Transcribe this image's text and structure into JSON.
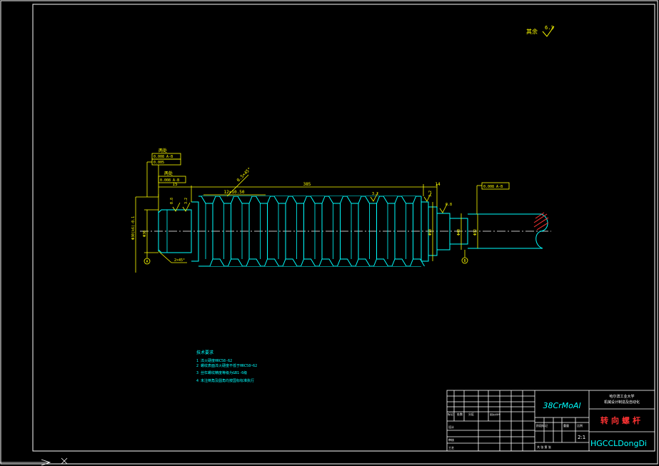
{
  "surface_finish": {
    "label": "其余",
    "value": "6.3"
  },
  "dims": {
    "two_places_a": "两处",
    "two_places_b": "两处",
    "tol_frame_a": "0.008 A-B",
    "tol_frame_b": "0.005",
    "tol_frame_c": "0.008 A-B",
    "tol_frame_right": "0.008 A-B",
    "len_left": "15",
    "len_main": "385",
    "len_pitch": "12×10.50",
    "len_right": "14",
    "angle_tag": "0.5×45°",
    "ra_left": "0.8",
    "ra_left2": "3.2",
    "ra_mid": "3.2",
    "ra_right": "3.2",
    "ra_right2": "0.8",
    "dia_left": "Φ30",
    "dia_left_fit": "Φ30(k6)-0.1",
    "dia_body": "Φ50",
    "dia_shaft": "Φ40",
    "dia_shaft2": "Φ32",
    "chamfer": "2×45°",
    "datum_a": "A",
    "datum_b": "B"
  },
  "notes": {
    "title": "技术要求",
    "lines": [
      "1 淬火硬度HRC58-62",
      "2 螺纹表面淬火硬度不低于HRC58~62",
      "3 丝杠螺纹精度等级为GB1-6级",
      "4 未注倒角及圆角均按国标标准执行"
    ]
  },
  "title_block": {
    "material": "38CrMoAl",
    "company_line1": "哈尔滨工业大学",
    "company_line2": "机械设计制造及自动化",
    "part_name": "转向螺杆",
    "scale_label": "比例",
    "scale_value": "2:1",
    "quantity_label": "件数",
    "weight_label": "重量",
    "stage_label": "阶段标记",
    "drawing_no": "HGCCLDongDi",
    "sheet_label": "共 张 第 张",
    "designer_label": "设计",
    "reviewer_label": "审核",
    "process_label": "工艺",
    "header_cells": [
      "标记",
      "处数",
      "分区",
      "更改文件号",
      "签名",
      "日期"
    ]
  },
  "colors": {
    "frame": "#ffffff",
    "outline": "#00ffff",
    "dimension": "#ffff00",
    "centerline": "#ffffff",
    "hatch": "#ff0000"
  }
}
